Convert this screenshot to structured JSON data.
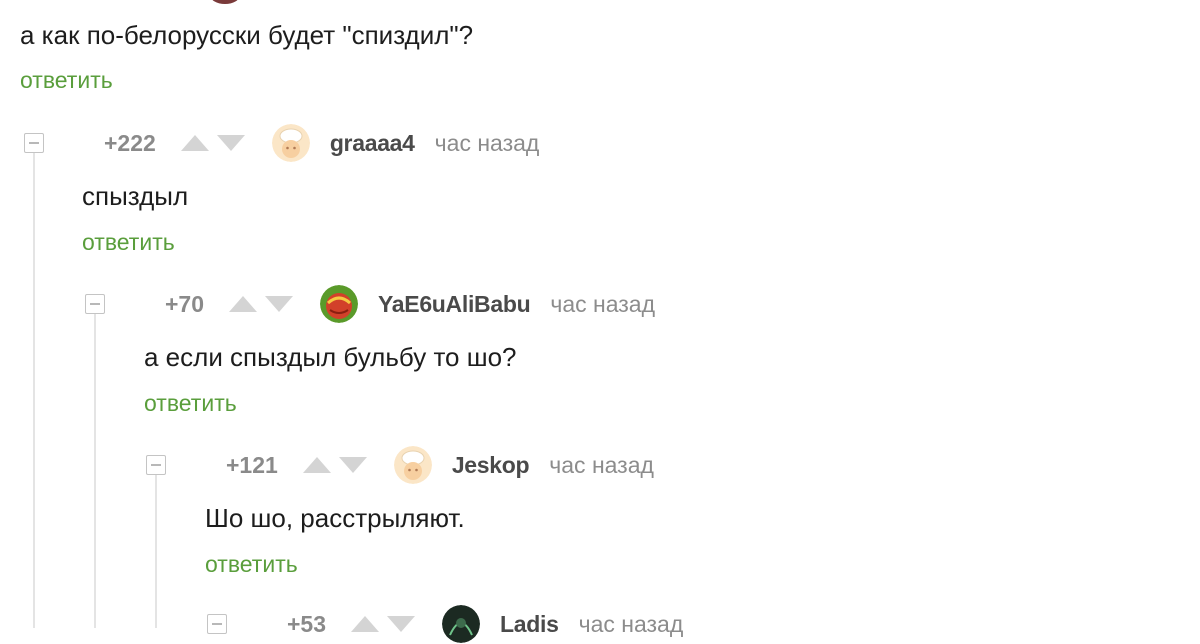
{
  "parent": {
    "text": "а как по-белорусски будет \"спиздил\"?",
    "reply_label": "ответить"
  },
  "comments": [
    {
      "rating": "+222",
      "username": "graaaa4",
      "time": "час назад",
      "text": "спыздыл",
      "reply_label": "ответить",
      "avatar_icon": "chef-avatar-icon"
    },
    {
      "rating": "+70",
      "username": "YaE6uAliBabu",
      "time": "час назад",
      "text": "а если спыздыл бульбу то шо?",
      "reply_label": "ответить",
      "avatar_icon": "red-ball-avatar-icon"
    },
    {
      "rating": "+121",
      "username": "Jeskop",
      "time": "час назад",
      "text": "Шо шо, расстрыляют.",
      "reply_label": "ответить",
      "avatar_icon": "chef-avatar-icon"
    },
    {
      "rating": "+53",
      "username": "Ladis",
      "time": "час назад",
      "avatar_icon": "dark-avatar-icon"
    }
  ],
  "colors": {
    "reply_link": "#5a9e3c",
    "meta_gray": "#8c8c8c",
    "thread_line": "#e4e4e4"
  }
}
